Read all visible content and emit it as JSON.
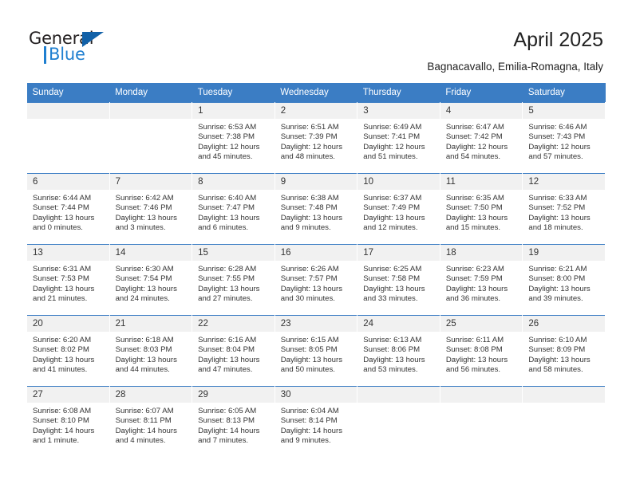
{
  "brand": {
    "name_part1": "General",
    "name_part2": "Blue"
  },
  "header": {
    "title": "April 2025",
    "subtitle": "Bagnacavallo, Emilia-Romagna, Italy"
  },
  "colors": {
    "header_blue": "#3b7dc4",
    "logo_blue": "#1f7fd0",
    "logo_triangle": "#1261a8",
    "daynum_band": "#f1f1f1",
    "text": "#333333"
  },
  "weekday_headers": [
    "Sunday",
    "Monday",
    "Tuesday",
    "Wednesday",
    "Thursday",
    "Friday",
    "Saturday"
  ],
  "weeks": [
    [
      {
        "day": "",
        "sunrise": "",
        "sunset": "",
        "daylight_line1": "",
        "daylight_line2": "",
        "blank": true
      },
      {
        "day": "",
        "sunrise": "",
        "sunset": "",
        "daylight_line1": "",
        "daylight_line2": "",
        "blank": true
      },
      {
        "day": "1",
        "sunrise": "Sunrise: 6:53 AM",
        "sunset": "Sunset: 7:38 PM",
        "daylight_line1": "Daylight: 12 hours",
        "daylight_line2": "and 45 minutes.",
        "blank": false
      },
      {
        "day": "2",
        "sunrise": "Sunrise: 6:51 AM",
        "sunset": "Sunset: 7:39 PM",
        "daylight_line1": "Daylight: 12 hours",
        "daylight_line2": "and 48 minutes.",
        "blank": false
      },
      {
        "day": "3",
        "sunrise": "Sunrise: 6:49 AM",
        "sunset": "Sunset: 7:41 PM",
        "daylight_line1": "Daylight: 12 hours",
        "daylight_line2": "and 51 minutes.",
        "blank": false
      },
      {
        "day": "4",
        "sunrise": "Sunrise: 6:47 AM",
        "sunset": "Sunset: 7:42 PM",
        "daylight_line1": "Daylight: 12 hours",
        "daylight_line2": "and 54 minutes.",
        "blank": false
      },
      {
        "day": "5",
        "sunrise": "Sunrise: 6:46 AM",
        "sunset": "Sunset: 7:43 PM",
        "daylight_line1": "Daylight: 12 hours",
        "daylight_line2": "and 57 minutes.",
        "blank": false
      }
    ],
    [
      {
        "day": "6",
        "sunrise": "Sunrise: 6:44 AM",
        "sunset": "Sunset: 7:44 PM",
        "daylight_line1": "Daylight: 13 hours",
        "daylight_line2": "and 0 minutes.",
        "blank": false
      },
      {
        "day": "7",
        "sunrise": "Sunrise: 6:42 AM",
        "sunset": "Sunset: 7:46 PM",
        "daylight_line1": "Daylight: 13 hours",
        "daylight_line2": "and 3 minutes.",
        "blank": false
      },
      {
        "day": "8",
        "sunrise": "Sunrise: 6:40 AM",
        "sunset": "Sunset: 7:47 PM",
        "daylight_line1": "Daylight: 13 hours",
        "daylight_line2": "and 6 minutes.",
        "blank": false
      },
      {
        "day": "9",
        "sunrise": "Sunrise: 6:38 AM",
        "sunset": "Sunset: 7:48 PM",
        "daylight_line1": "Daylight: 13 hours",
        "daylight_line2": "and 9 minutes.",
        "blank": false
      },
      {
        "day": "10",
        "sunrise": "Sunrise: 6:37 AM",
        "sunset": "Sunset: 7:49 PM",
        "daylight_line1": "Daylight: 13 hours",
        "daylight_line2": "and 12 minutes.",
        "blank": false
      },
      {
        "day": "11",
        "sunrise": "Sunrise: 6:35 AM",
        "sunset": "Sunset: 7:50 PM",
        "daylight_line1": "Daylight: 13 hours",
        "daylight_line2": "and 15 minutes.",
        "blank": false
      },
      {
        "day": "12",
        "sunrise": "Sunrise: 6:33 AM",
        "sunset": "Sunset: 7:52 PM",
        "daylight_line1": "Daylight: 13 hours",
        "daylight_line2": "and 18 minutes.",
        "blank": false
      }
    ],
    [
      {
        "day": "13",
        "sunrise": "Sunrise: 6:31 AM",
        "sunset": "Sunset: 7:53 PM",
        "daylight_line1": "Daylight: 13 hours",
        "daylight_line2": "and 21 minutes.",
        "blank": false
      },
      {
        "day": "14",
        "sunrise": "Sunrise: 6:30 AM",
        "sunset": "Sunset: 7:54 PM",
        "daylight_line1": "Daylight: 13 hours",
        "daylight_line2": "and 24 minutes.",
        "blank": false
      },
      {
        "day": "15",
        "sunrise": "Sunrise: 6:28 AM",
        "sunset": "Sunset: 7:55 PM",
        "daylight_line1": "Daylight: 13 hours",
        "daylight_line2": "and 27 minutes.",
        "blank": false
      },
      {
        "day": "16",
        "sunrise": "Sunrise: 6:26 AM",
        "sunset": "Sunset: 7:57 PM",
        "daylight_line1": "Daylight: 13 hours",
        "daylight_line2": "and 30 minutes.",
        "blank": false
      },
      {
        "day": "17",
        "sunrise": "Sunrise: 6:25 AM",
        "sunset": "Sunset: 7:58 PM",
        "daylight_line1": "Daylight: 13 hours",
        "daylight_line2": "and 33 minutes.",
        "blank": false
      },
      {
        "day": "18",
        "sunrise": "Sunrise: 6:23 AM",
        "sunset": "Sunset: 7:59 PM",
        "daylight_line1": "Daylight: 13 hours",
        "daylight_line2": "and 36 minutes.",
        "blank": false
      },
      {
        "day": "19",
        "sunrise": "Sunrise: 6:21 AM",
        "sunset": "Sunset: 8:00 PM",
        "daylight_line1": "Daylight: 13 hours",
        "daylight_line2": "and 39 minutes.",
        "blank": false
      }
    ],
    [
      {
        "day": "20",
        "sunrise": "Sunrise: 6:20 AM",
        "sunset": "Sunset: 8:02 PM",
        "daylight_line1": "Daylight: 13 hours",
        "daylight_line2": "and 41 minutes.",
        "blank": false
      },
      {
        "day": "21",
        "sunrise": "Sunrise: 6:18 AM",
        "sunset": "Sunset: 8:03 PM",
        "daylight_line1": "Daylight: 13 hours",
        "daylight_line2": "and 44 minutes.",
        "blank": false
      },
      {
        "day": "22",
        "sunrise": "Sunrise: 6:16 AM",
        "sunset": "Sunset: 8:04 PM",
        "daylight_line1": "Daylight: 13 hours",
        "daylight_line2": "and 47 minutes.",
        "blank": false
      },
      {
        "day": "23",
        "sunrise": "Sunrise: 6:15 AM",
        "sunset": "Sunset: 8:05 PM",
        "daylight_line1": "Daylight: 13 hours",
        "daylight_line2": "and 50 minutes.",
        "blank": false
      },
      {
        "day": "24",
        "sunrise": "Sunrise: 6:13 AM",
        "sunset": "Sunset: 8:06 PM",
        "daylight_line1": "Daylight: 13 hours",
        "daylight_line2": "and 53 minutes.",
        "blank": false
      },
      {
        "day": "25",
        "sunrise": "Sunrise: 6:11 AM",
        "sunset": "Sunset: 8:08 PM",
        "daylight_line1": "Daylight: 13 hours",
        "daylight_line2": "and 56 minutes.",
        "blank": false
      },
      {
        "day": "26",
        "sunrise": "Sunrise: 6:10 AM",
        "sunset": "Sunset: 8:09 PM",
        "daylight_line1": "Daylight: 13 hours",
        "daylight_line2": "and 58 minutes.",
        "blank": false
      }
    ],
    [
      {
        "day": "27",
        "sunrise": "Sunrise: 6:08 AM",
        "sunset": "Sunset: 8:10 PM",
        "daylight_line1": "Daylight: 14 hours",
        "daylight_line2": "and 1 minute.",
        "blank": false
      },
      {
        "day": "28",
        "sunrise": "Sunrise: 6:07 AM",
        "sunset": "Sunset: 8:11 PM",
        "daylight_line1": "Daylight: 14 hours",
        "daylight_line2": "and 4 minutes.",
        "blank": false
      },
      {
        "day": "29",
        "sunrise": "Sunrise: 6:05 AM",
        "sunset": "Sunset: 8:13 PM",
        "daylight_line1": "Daylight: 14 hours",
        "daylight_line2": "and 7 minutes.",
        "blank": false
      },
      {
        "day": "30",
        "sunrise": "Sunrise: 6:04 AM",
        "sunset": "Sunset: 8:14 PM",
        "daylight_line1": "Daylight: 14 hours",
        "daylight_line2": "and 9 minutes.",
        "blank": false
      },
      {
        "day": "",
        "sunrise": "",
        "sunset": "",
        "daylight_line1": "",
        "daylight_line2": "",
        "blank": true
      },
      {
        "day": "",
        "sunrise": "",
        "sunset": "",
        "daylight_line1": "",
        "daylight_line2": "",
        "blank": true
      },
      {
        "day": "",
        "sunrise": "",
        "sunset": "",
        "daylight_line1": "",
        "daylight_line2": "",
        "blank": true
      }
    ]
  ]
}
